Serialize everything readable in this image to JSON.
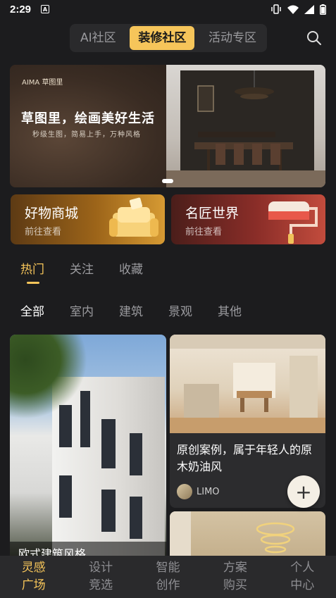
{
  "status_bar": {
    "time": "2:29",
    "a_badge": "A"
  },
  "top_tabs": [
    {
      "label": "AI社区",
      "active": false
    },
    {
      "label": "装修社区",
      "active": true
    },
    {
      "label": "活动专区",
      "active": false
    }
  ],
  "banner": {
    "logo": "AIMA 草图里",
    "title": "草图里，绘画美好生活",
    "subtitle": "秒级生图，简易上手，万种风格"
  },
  "cards": {
    "shop": {
      "title": "好物商城",
      "subtitle": "前往查看"
    },
    "master": {
      "title": "名匠世界",
      "subtitle": "前往查看"
    }
  },
  "feed_tabs": [
    {
      "label": "热门",
      "active": true
    },
    {
      "label": "关注",
      "active": false
    },
    {
      "label": "收藏",
      "active": false
    }
  ],
  "category_tabs": [
    {
      "label": "全部",
      "active": true
    },
    {
      "label": "室内",
      "active": false
    },
    {
      "label": "建筑",
      "active": false
    },
    {
      "label": "景观",
      "active": false
    },
    {
      "label": "其他",
      "active": false
    }
  ],
  "posts": {
    "a": {
      "title": "欧式建筑风格"
    },
    "b": {
      "title": "原创案例，属于年轻人的原木奶油风",
      "author": "LIMO"
    }
  },
  "fab": {
    "symbol": "+"
  },
  "bottom_nav": [
    {
      "line1": "灵感",
      "line2": "广场",
      "active": true
    },
    {
      "line1": "设计",
      "line2": "竞选",
      "active": false
    },
    {
      "line1": "智能",
      "line2": "创作",
      "active": false
    },
    {
      "line1": "方案",
      "line2": "购买",
      "active": false
    },
    {
      "line1": "个人",
      "line2": "中心",
      "active": false
    }
  ],
  "colors": {
    "accent": "#f6c55a",
    "background": "#1c1c1e",
    "nav_bg": "#2a2a2c"
  }
}
